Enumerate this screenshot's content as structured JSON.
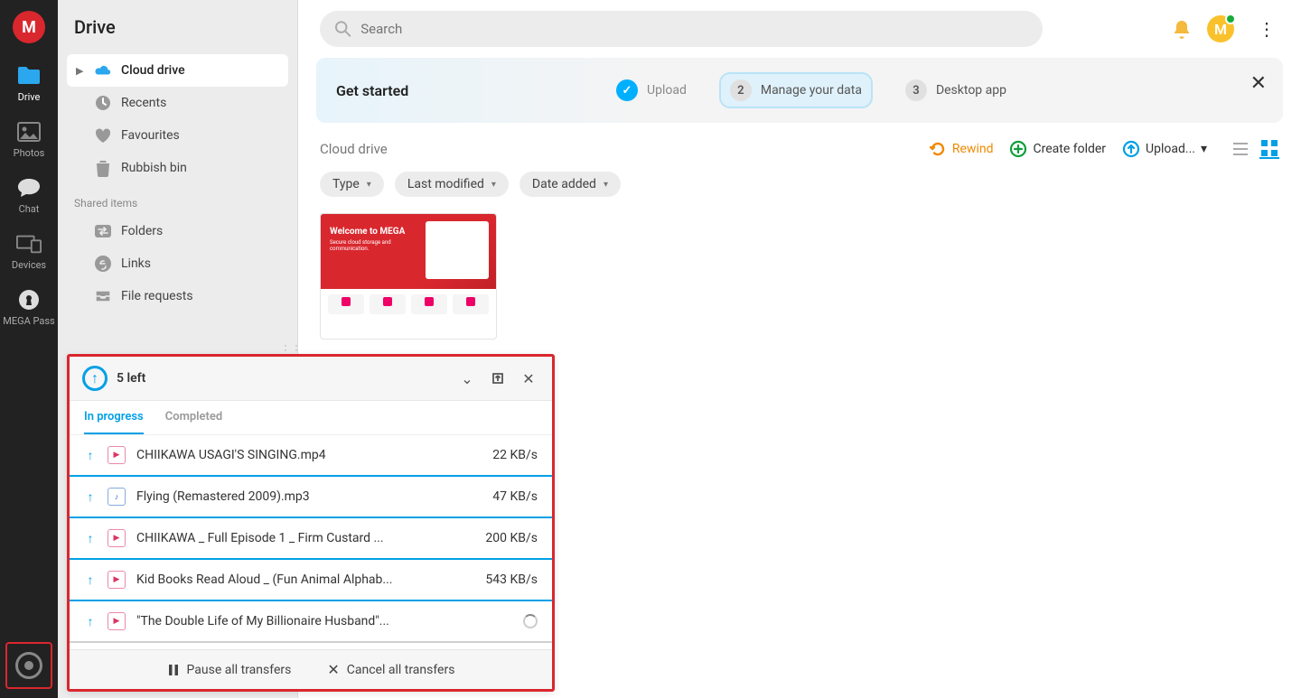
{
  "brand_letter": "M",
  "rail": [
    {
      "label": "Drive"
    },
    {
      "label": "Photos"
    },
    {
      "label": "Chat"
    },
    {
      "label": "Devices"
    },
    {
      "label": "MEGA Pass"
    }
  ],
  "sidebar": {
    "title": "Drive",
    "items": [
      {
        "label": "Cloud drive"
      },
      {
        "label": "Recents"
      },
      {
        "label": "Favourites"
      },
      {
        "label": "Rubbish bin"
      }
    ],
    "shared_label": "Shared items",
    "shared": [
      {
        "label": "Folders"
      },
      {
        "label": "Links"
      },
      {
        "label": "File requests"
      }
    ]
  },
  "search": {
    "placeholder": "Search"
  },
  "avatar_letter": "M",
  "banner": {
    "title": "Get started",
    "steps": [
      {
        "label": "Upload",
        "done": true
      },
      {
        "label": "Manage your data",
        "badge": "2",
        "active": true
      },
      {
        "label": "Desktop app",
        "badge": "3"
      }
    ]
  },
  "crumb": "Cloud drive",
  "tools": {
    "rewind": "Rewind",
    "create_folder": "Create folder",
    "upload": "Upload..."
  },
  "chips": [
    {
      "label": "Type"
    },
    {
      "label": "Last modified"
    },
    {
      "label": "Date added"
    }
  ],
  "thumb": {
    "headline": "Welcome to MEGA",
    "sub": "Secure cloud storage and communication."
  },
  "transfers": {
    "title": "5 left",
    "tabs": {
      "in_progress": "In progress",
      "completed": "Completed"
    },
    "items": [
      {
        "name": "CHIIKAWA USAGI'S SINGING.mp4",
        "speed": "22 KB/s",
        "type": "video"
      },
      {
        "name": "Flying (Remastered 2009).mp3",
        "speed": "47 KB/s",
        "type": "audio"
      },
      {
        "name": "CHIIKAWA _ Full Episode 1 _ Firm Custard ...",
        "speed": "200 KB/s",
        "type": "video"
      },
      {
        "name": "Kid Books Read Aloud _ (Fun Animal Alphab...",
        "speed": "543 KB/s",
        "type": "video"
      },
      {
        "name": "\"The Double Life of My Billionaire Husband\"...",
        "speed": "",
        "type": "video",
        "spinner": true
      }
    ],
    "pause": "Pause all transfers",
    "cancel": "Cancel all transfers"
  }
}
